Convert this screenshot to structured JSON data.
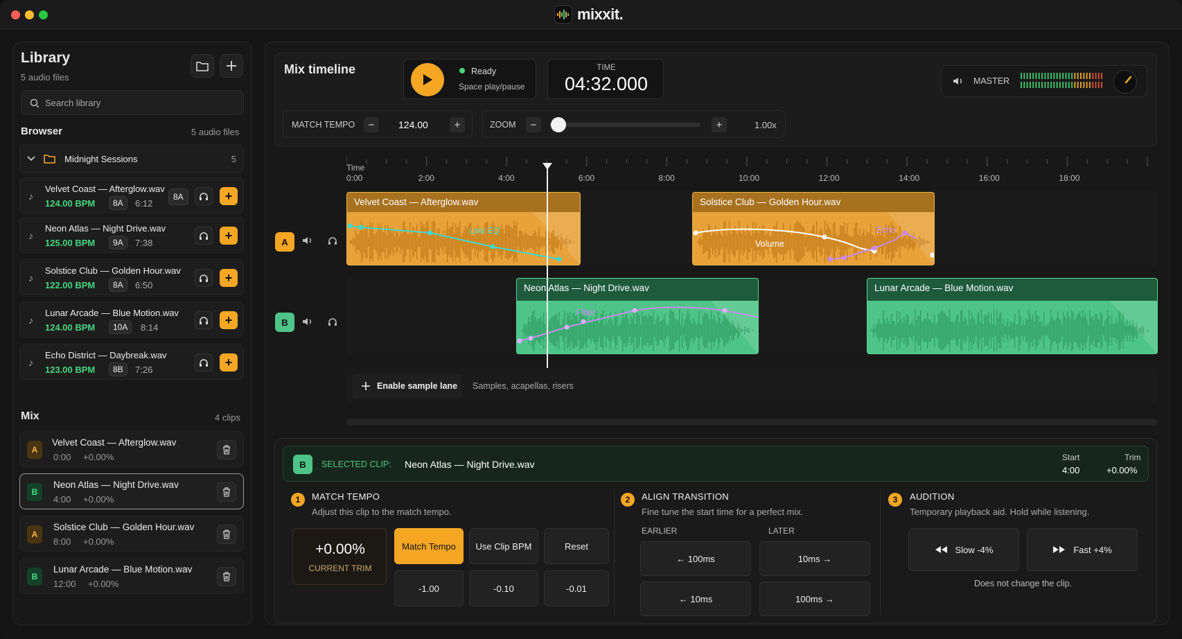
{
  "app": {
    "name": "mixxit."
  },
  "library": {
    "title": "Library",
    "count": "5 audio files",
    "search_placeholder": "Search library",
    "browser_title": "Browser",
    "browser_count": "5 audio files",
    "folder": {
      "name": "Midnight Sessions",
      "count": "5"
    },
    "tracks": [
      {
        "name": "Velvet Coast — Afterglow.wav",
        "bpm": "124.00 BPM",
        "key": "8A",
        "duration": "6:12",
        "extra_key": "8A"
      },
      {
        "name": "Neon Atlas — Night Drive.wav",
        "bpm": "125.00 BPM",
        "key": "9A",
        "duration": "7:38"
      },
      {
        "name": "Solstice Club — Golden Hour.wav",
        "bpm": "122.00 BPM",
        "key": "8A",
        "duration": "6:50"
      },
      {
        "name": "Lunar Arcade — Blue Motion.wav",
        "bpm": "124.00 BPM",
        "key": "10A",
        "duration": "8:14"
      },
      {
        "name": "Echo District — Daybreak.wav",
        "bpm": "123.00 BPM",
        "key": "8B",
        "duration": "7:26"
      }
    ]
  },
  "mix": {
    "title": "Mix",
    "count": "4 clips",
    "clips": [
      {
        "deck": "A",
        "name": "Velvet Coast — Afterglow.wav",
        "start": "0:00",
        "trim": "+0.00%"
      },
      {
        "deck": "B",
        "name": "Neon Atlas — Night Drive.wav",
        "start": "4:00",
        "trim": "+0.00%"
      },
      {
        "deck": "A",
        "name": "Solstice Club — Golden Hour.wav",
        "start": "8:00",
        "trim": "+0.00%"
      },
      {
        "deck": "B",
        "name": "Lunar Arcade — Blue Motion.wav",
        "start": "12:00",
        "trim": "+0.00%"
      }
    ]
  },
  "timeline": {
    "title": "Mix timeline",
    "status": "Ready",
    "status_hint": "Space play/pause",
    "time_label": "TIME",
    "time_value": "04:32.000",
    "master_label": "MASTER",
    "match_tempo_label": "MATCH TEMPO",
    "tempo_value": "124.00",
    "zoom_label": "ZOOM",
    "zoom_value": "1.00x",
    "zoom_level": 0.0,
    "ruler_title": "Time",
    "ticks": [
      "0:00",
      "2:00",
      "4:00",
      "6:00",
      "8:00",
      "10:00",
      "12:00",
      "14:00",
      "16:00",
      "18:00"
    ],
    "deck_a": "A",
    "deck_b": "B",
    "lane_a_clips": [
      {
        "name": "Velvet Coast — Afterglow.wav",
        "automation": "Low EQ"
      },
      {
        "name": "Solstice Club — Golden Hour.wav",
        "automation": "Volume",
        "automation2": "Echo"
      }
    ],
    "lane_b_clips": [
      {
        "name": "Neon Atlas — Night Drive.wav",
        "automation": "Filter"
      },
      {
        "name": "Lunar Arcade — Blue Motion.wav"
      }
    ],
    "sample_lane_label": "Enable sample lane",
    "sample_lane_hint": "Samples, acapellas, risers"
  },
  "selected": {
    "deck": "B",
    "label": "SELECTED CLIP:",
    "name": "Neon Atlas — Night Drive.wav",
    "start_label": "Start",
    "start": "4:00",
    "trim_label": "Trim",
    "trim": "+0.00%",
    "s1": {
      "num": "1",
      "title": "MATCH TEMPO",
      "sub": "Adjust this clip to the match tempo.",
      "trim_value": "+0.00%",
      "trim_caption": "CURRENT TRIM",
      "match": "Match Tempo",
      "use_bpm": "Use Clip BPM",
      "reset": "Reset",
      "n1": "-1.00",
      "n2": "-0.10",
      "n3": "-0.01"
    },
    "s2": {
      "num": "2",
      "title": "ALIGN TRANSITION",
      "sub": "Fine tune the start time for a perfect mix.",
      "earlier": "EARLIER",
      "later": "LATER",
      "e100": "← 100ms",
      "l10": "10ms →",
      "e10": "← 10ms",
      "l100": "100ms →"
    },
    "s3": {
      "num": "3",
      "title": "AUDITION",
      "sub": "Temporary playback aid. Hold while listening.",
      "slow": "Slow -4%",
      "fast": "Fast +4%",
      "note": "Does not change the clip."
    }
  },
  "colors": {
    "accent": "#f5a623",
    "green": "#4fc488",
    "cyan": "#3fd8d0",
    "violet": "#c98bf0"
  }
}
